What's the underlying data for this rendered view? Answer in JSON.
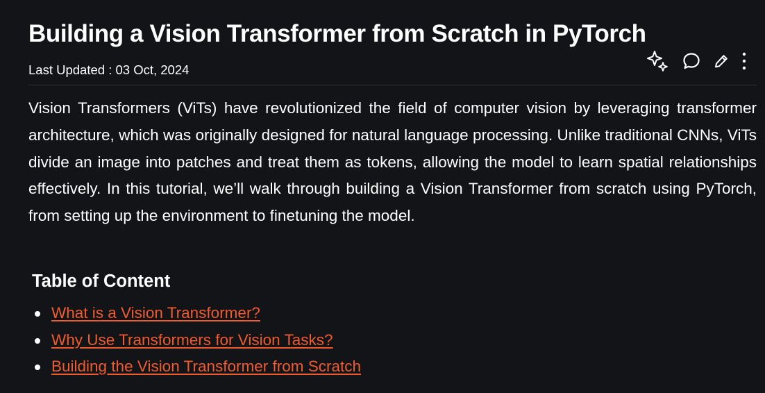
{
  "article": {
    "title": "Building a Vision Transformer from Scratch in PyTorch",
    "last_updated": "Last Updated : 03 Oct, 2024",
    "actions": [
      {
        "name": "ai-summary-icon",
        "icon": "sparkles-icon"
      },
      {
        "name": "comment-icon",
        "icon": "speech-bubble-icon"
      },
      {
        "name": "edit-icon",
        "icon": "pencil-icon"
      },
      {
        "name": "more-options-icon",
        "icon": "vertical-dots-icon"
      }
    ],
    "intro": "Vision Transformers (ViTs) have revolutionized the field of computer vision by leveraging transformer architecture, which was originally designed for natural language processing. Unlike traditional CNNs, ViTs divide an image into patches and treat them as tokens, allowing the model to learn spatial relationships effectively. In this tutorial, we’ll walk through building a Vision Transformer from scratch using PyTorch, from setting up the environment to fine­tuning the model."
  },
  "toc": {
    "heading": "Table of Content",
    "items": [
      {
        "label": "What is a Vision Transformer?"
      },
      {
        "label": "Why Use Transformers for Vision Tasks?"
      },
      {
        "label": "Building the Vision Transformer from Scratch"
      }
    ]
  },
  "colors": {
    "background": "#131417",
    "text": "#ffffff",
    "link": "#f05b2e",
    "divider": "#2e3036"
  }
}
